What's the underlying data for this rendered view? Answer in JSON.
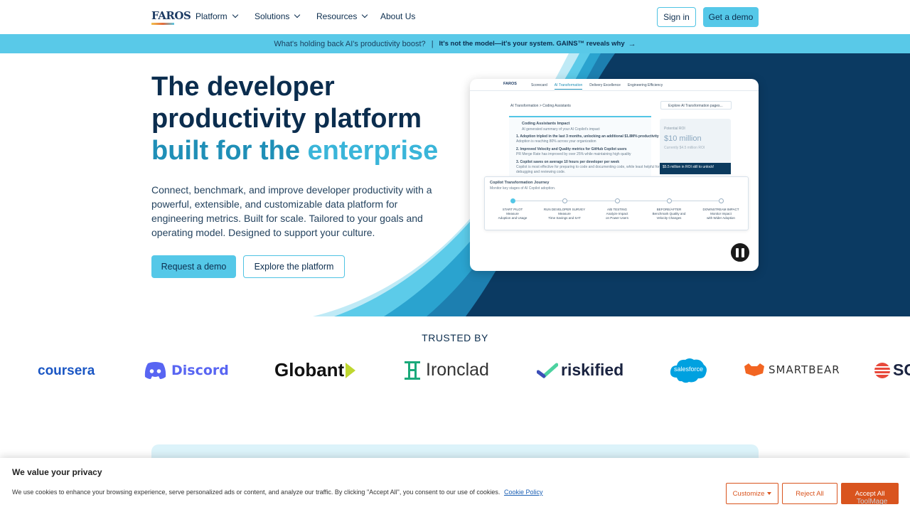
{
  "nav": {
    "logo_text": "FAROS",
    "items": [
      {
        "label": "Platform",
        "dropdown": true
      },
      {
        "label": "Solutions",
        "dropdown": true
      },
      {
        "label": "Resources",
        "dropdown": true
      },
      {
        "label": "About Us",
        "dropdown": false
      }
    ],
    "sign_in": "Sign in",
    "get_demo": "Get a demo"
  },
  "banner": {
    "question": "What's holding back AI's productivity boost?",
    "separator": "|",
    "link": "It's not the model—it's your system. GAINS™ reveals why",
    "arrow": "→"
  },
  "hero": {
    "title_line1": "The developer",
    "title_line2": "productivity platform",
    "title_line3_part1": "built for the ",
    "title_line3_part2": "enterprise",
    "description": "Connect, benchmark, and improve developer productivity with a powerful, extensible, and customizable data platform for engineering metrics. Built for scale. Tailored to your goals and operating model. Designed to support your culture.",
    "request_demo": "Request a demo",
    "explore": "Explore the platform"
  },
  "screenshot": {
    "logo": "FAROS",
    "tabs": [
      "Scorecard",
      "AI Transformation",
      "Delivery Excellence",
      "Engineering Efficiency"
    ],
    "active_tab": "AI Transformation",
    "breadcrumb": "AI Transformation  >  Coding Assistants",
    "explore_select": "Explore AI Transformation pages...",
    "impact_title": "Coding Assistants Impact",
    "impact_subtitle": "AI generated summary of your AI Copilot's impact",
    "impact_items": [
      "1.  Adoption tripled in the last 3 months, unlocking an additional $1.8M% productivity gains",
      "      Adoption is reaching 80% across your organization",
      "2.  Improved Velocity and Quality metrics for GitHub Copilot users",
      "      PR Merge Rate has improved by over 25% while maintaining high quality",
      "3.  Copilot saves on average 10 hours per developer per week",
      "      Copilot is most effective for preparing to code and documenting code, while least helpful for",
      "      debugging and reviewing code."
    ],
    "roi_label": "Potential ROI",
    "roi_value": "$10 million",
    "roi_sub": "Currently $4.5 million ROI",
    "roi_strip": "$5.5 million in ROI still to unlock!",
    "journey_title": "Copilot Transformation Journey",
    "journey_subtitle": "Monitor key stages of AI Copilot adoption.",
    "journey_steps": [
      {
        "title": "START PILOT",
        "line1": "Measure",
        "line2": "Adoption and Usage",
        "done": true
      },
      {
        "title": "RUN DEVELOPER SURVEY",
        "line1": "Measure",
        "line2": "Time Savings and SAT",
        "done": false
      },
      {
        "title": "A/B TESTING",
        "line1": "Analyze Impact",
        "line2": "on Power Users",
        "done": false
      },
      {
        "title": "BEFORE/AFTER",
        "line1": "Benchmark Quality and",
        "line2": "Velocity Changes",
        "done": false
      },
      {
        "title": "DOWNSTREAM IMPACT",
        "line1": "Monitor Impact",
        "line2": "with Wider Adoption",
        "done": false
      }
    ]
  },
  "trusted": {
    "heading": "TRUSTED BY",
    "brands": [
      "coursera",
      "Discord",
      "Globant",
      "Ironclad",
      "riskified",
      "salesforce",
      "SMARTBEAR",
      "SC"
    ]
  },
  "cookie": {
    "title": "We value your privacy",
    "text": "We use cookies to enhance your browsing experience, serve personalized ads or content, and analyze our traffic. By clicking \"Accept All\", you consent to our use of cookies.",
    "policy_link": "Cookie Policy",
    "customize": "Customize",
    "reject": "Reject All",
    "accept": "Accept All"
  },
  "watermark": "ToolMage",
  "colors": {
    "navy": "#0b2d4e",
    "accent": "#55c8e8",
    "hero_dark": "#0b3a62",
    "cookie_orange": "#d9541e"
  }
}
